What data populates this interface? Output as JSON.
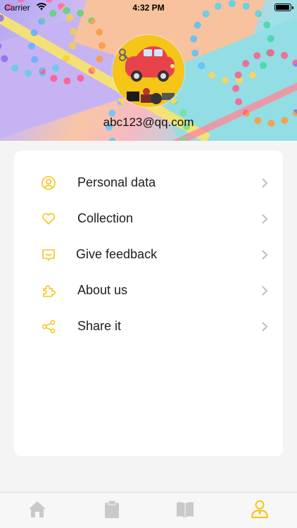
{
  "status_bar": {
    "carrier": "Carrier",
    "time": "4:32 PM",
    "battery_level": 0.9
  },
  "profile": {
    "email": "abc123@qq.com",
    "avatar_icon": "toy-car-icon"
  },
  "menu": {
    "items": [
      {
        "label": "Personal data",
        "icon": "user-circle-icon"
      },
      {
        "label": "Collection",
        "icon": "heart-icon"
      },
      {
        "label": "Give feedback",
        "icon": "message-icon"
      },
      {
        "label": "About us",
        "icon": "puzzle-icon"
      },
      {
        "label": "Share it",
        "icon": "share-icon"
      }
    ]
  },
  "tab_bar": {
    "tabs": [
      {
        "icon": "home-icon",
        "active": false
      },
      {
        "icon": "clipboard-icon",
        "active": false
      },
      {
        "icon": "book-icon",
        "active": false
      },
      {
        "icon": "profile-icon",
        "active": true
      }
    ]
  },
  "colors": {
    "accent": "#F5C518",
    "inactive_icon": "#C9C9C9",
    "chevron": "#BDBDBD"
  }
}
